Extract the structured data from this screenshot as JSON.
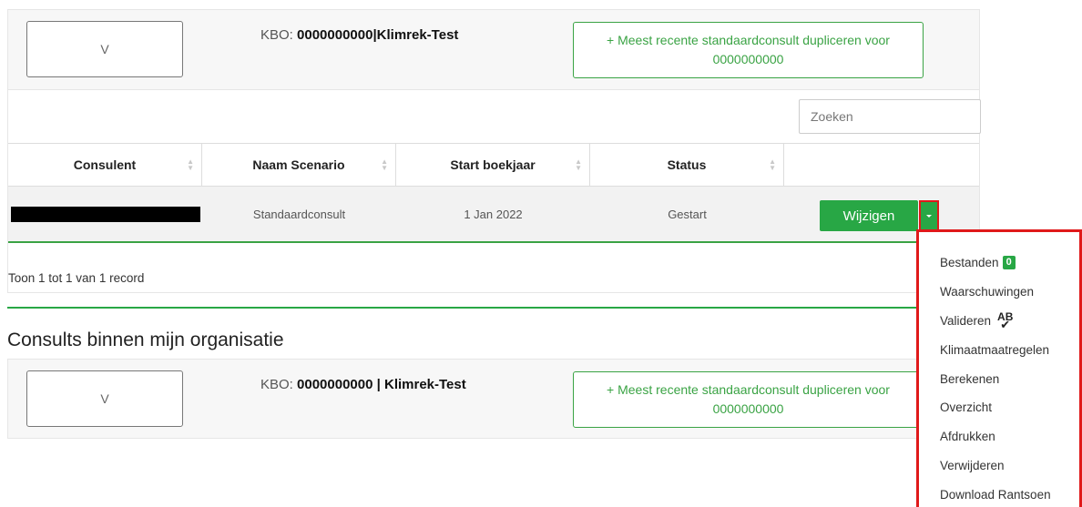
{
  "panel1": {
    "v_label": "V",
    "kbo_label": "KBO:",
    "kbo_value": "0000000000|Klimrek-Test",
    "duplicate_line1": "+ Meest recente standaardconsult dupliceren voor",
    "duplicate_line2": "0000000000",
    "search_placeholder": "Zoeken",
    "columns": [
      "Consulent",
      "Naam Scenario",
      "Start boekjaar",
      "Status"
    ],
    "row": {
      "consulent": "",
      "naam_scenario": "Standaardconsult",
      "start_boekjaar": "1 Jan 2022",
      "status": "Gestart",
      "edit_label": "Wijzigen"
    },
    "info": "Toon 1 tot 1 van 1 record"
  },
  "section_title": "Consults binnen mijn organisatie",
  "panel2": {
    "v_label": "V",
    "kbo_label": "KBO:",
    "kbo_value": "0000000000 | Klimrek-Test",
    "duplicate_line1": "+ Meest recente standaardconsult dupliceren voor",
    "duplicate_line2": "0000000000"
  },
  "menu": {
    "items": [
      "Bestanden",
      "Waarschuwingen",
      "Valideren",
      "Klimaatmaatregelen",
      "Berekenen",
      "Overzicht",
      "Afdrukken",
      "Verwijderen",
      "Download Rantsoen"
    ],
    "bestanden_badge": "0",
    "valideren_icon_text": "AB"
  },
  "colors": {
    "accent_green": "#28a745",
    "highlight_red": "#e0191a"
  },
  "icons": {
    "sort": "sort-arrows-icon",
    "caret": "caret-down-icon",
    "spellcheck": "spellcheck-icon"
  }
}
